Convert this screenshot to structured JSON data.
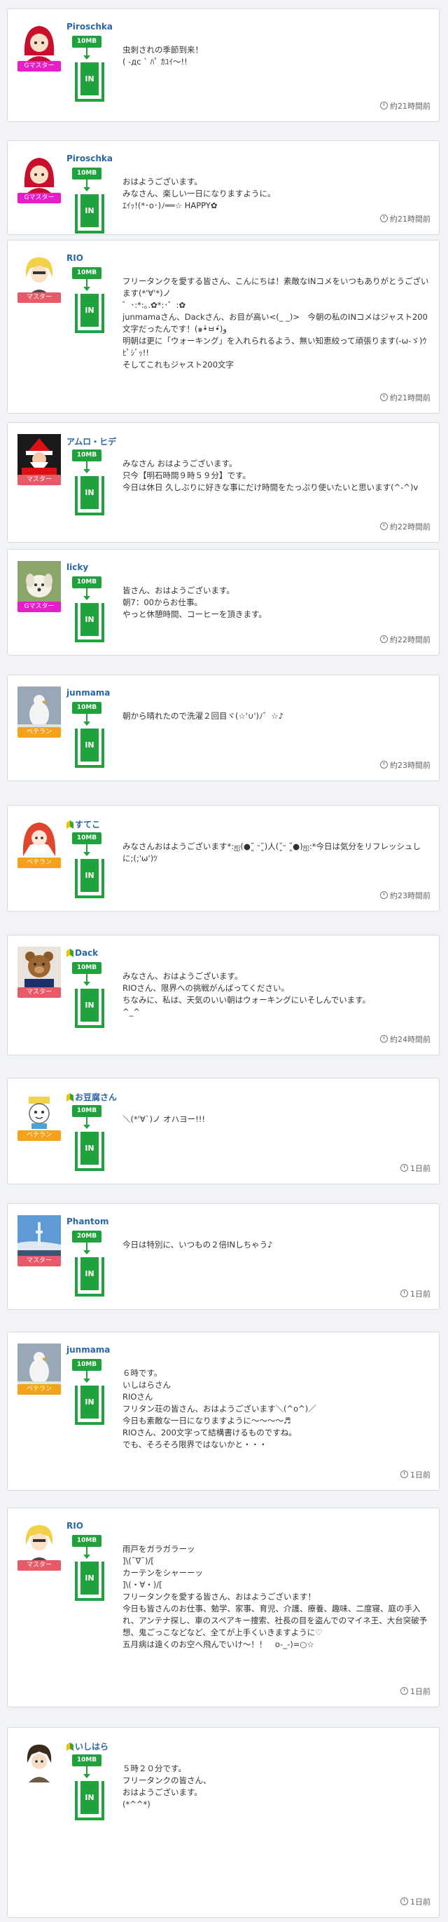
{
  "colors": {
    "accent_green": "#1fa13c",
    "username_blue": "#2a66a8",
    "role_g_master": "#e61ec7",
    "role_master": "#e85a68",
    "role_veteran": "#f5a11a",
    "beginner_leaf": "green-yellow leaf"
  },
  "posts": [
    {
      "avatar_icon": "red-hooded-girl-avatar",
      "username": "Piroschka",
      "beginner": false,
      "role": "Gマスター",
      "role_color": "#e61ec7",
      "size": "10MB",
      "in_label": "IN",
      "message": "虫刺されの季節到来！\n( -дс ` ﾊﾟ ｶﾕｲ〜!!",
      "time": "約21時間前"
    },
    {
      "avatar_icon": "red-hooded-girl-avatar",
      "username": "Piroschka",
      "beginner": false,
      "role": "Gマスター",
      "role_color": "#e61ec7",
      "size": "10MB",
      "in_label": "IN",
      "message": "おはようございます。\nみなさん、楽しい一日になりますように。\nｴｲｯ!(*･o･)ﾉ══☆ HAPPY✿",
      "time": "約21時間前"
    },
    {
      "avatar_icon": "blonde-character-avatar",
      "username": "RIO",
      "beginner": false,
      "role": "マスター",
      "role_color": "#e85a68",
      "size": "10MB",
      "in_label": "IN",
      "message": "フリータンクを愛する皆さん、こんにちは！素敵なINコメをいつもありがとうございます(*'∀'*)ノ\n゜･:*:｡.✿*:･゜:✿\njunmamaさん、Dackさん、お目が高い<(_ _)>　今朝の私のINコメはジャスト200文字だったんです！(๑•̀ㅂ•́)و\n明朝は更に「ウォーキング」を入れられるよう、無い知恵絞って頑張ります(-ω-ゞ)ｳﾋﾟｼﾞｯ!!\nそしてこれもジャスト200文字",
      "time": "約21時間前"
    },
    {
      "avatar_icon": "santa-claus-avatar",
      "username": "アムロ・ヒデ",
      "beginner": false,
      "role": "マスター",
      "role_color": "#e85a68",
      "size": "10MB",
      "in_label": "IN",
      "message": "みなさん おはようございます。\n只今【明石時間９時５９分】です。\n今日は休日 久しぶりに好きな事にだけ時間をたっぷり使いたいと思います(^-^)v",
      "time": "約22時間前"
    },
    {
      "avatar_icon": "white-dog-avatar",
      "username": "licky",
      "beginner": false,
      "role": "Gマスター",
      "role_color": "#e61ec7",
      "size": "10MB",
      "in_label": "IN",
      "message": "皆さん、おはようございます。\n朝7：00からお仕事。\nやっと休憩時間、コーヒーを頂きます。",
      "time": "約22時間前"
    },
    {
      "avatar_icon": "snowy-bird-avatar",
      "username": "junmama",
      "beginner": false,
      "role": "ベテラン",
      "role_color": "#f5a11a",
      "size": "10MB",
      "in_label": "IN",
      "message": "朝から晴れたので洗濯２回目ヾ(☆'∪')ﾉ゛☆♪",
      "time": "約23時間前"
    },
    {
      "avatar_icon": "red-haired-anime-girl-avatar",
      "username": "すてこ",
      "beginner": true,
      "role": "ベテラン",
      "role_color": "#f5a11a",
      "size": "10MB",
      "in_label": "IN",
      "message": "みなさんおはようございます*:ஐ(●˘͈ ᵕ˘͈)人(˘͈ᵕ ˘͈●)ஐ:*今日は気分をリフレッシュしに;(;'ω')ﾂ",
      "time": "約23時間前"
    },
    {
      "avatar_icon": "teddy-bear-avatar",
      "username": "Dack",
      "beginner": true,
      "role": "マスター",
      "role_color": "#e85a68",
      "size": "10MB",
      "in_label": "IN",
      "message": "みなさん、おはようございます。\nRIOさん、限界への挑戦がんばってください。\nちなみに、私は、天気のいい朝はウォーキングにいそしんでいます。\n^_^",
      "time": "約24時間前"
    },
    {
      "avatar_icon": "tofu-mascot-avatar",
      "username": "お豆腐さん",
      "beginner": true,
      "role": "ベテラン",
      "role_color": "#f5a11a",
      "size": "10MB",
      "in_label": "IN",
      "message": "＼(*'∀`)ノ オハヨー!!!",
      "time": "1日前"
    },
    {
      "avatar_icon": "tower-landscape-avatar",
      "username": "Phantom",
      "beginner": false,
      "role": "マスター",
      "role_color": "#e85a68",
      "size": "20MB",
      "in_label": "IN",
      "message": "今日は特別に、いつもの２倍INしちゃう♪",
      "time": "1日前"
    },
    {
      "avatar_icon": "snowy-bird-avatar",
      "username": "junmama",
      "beginner": false,
      "role": "ベテラン",
      "role_color": "#f5a11a",
      "size": "10MB",
      "in_label": "IN",
      "message": "６時です。\nいしはらさん\nRIOさん\nフリタン荘の皆さん、おはようございます＼(^o^)／\n今日も素敵な一日になりますように〜〜〜〜♬\nRIOさん、200文字って結構書けるものですね。\nでも、そろそろ限界ではないかと・・・",
      "time": "1日前"
    },
    {
      "avatar_icon": "blonde-character-avatar",
      "username": "RIO",
      "beginner": false,
      "role": "マスター",
      "role_color": "#e85a68",
      "size": "10MB",
      "in_label": "IN",
      "message": "雨戸をガラガラーッ\n]\\(¯∇¯)/[\nカーテンをシャーーッ\n]\\(・∀・)/[\nフリータンクを愛する皆さん、おはようございます！\n今日も皆さんのお仕事、勉学、家事、育児、介護、療養、趣味、二度寝、庭の手入れ、アンテナ探し、車のスペアキー捜索、社長の目を盗んでのマイネ王、大台突破予想、鬼ごっこなどなど、全てが上手くいきますように♡\n五月病は遠くのお空へ飛んでいけ〜！！　o-_-)=○☆",
      "time": "1日前"
    },
    {
      "avatar_icon": "dark-haired-character-avatar",
      "username": "いしはら",
      "beginner": true,
      "role": "",
      "role_color": "",
      "size": "10MB",
      "in_label": "IN",
      "message": "５時２０分です。\nフリータンクの皆さん、\nおはようございます。\n(*^^*)",
      "time": "1日前"
    }
  ]
}
